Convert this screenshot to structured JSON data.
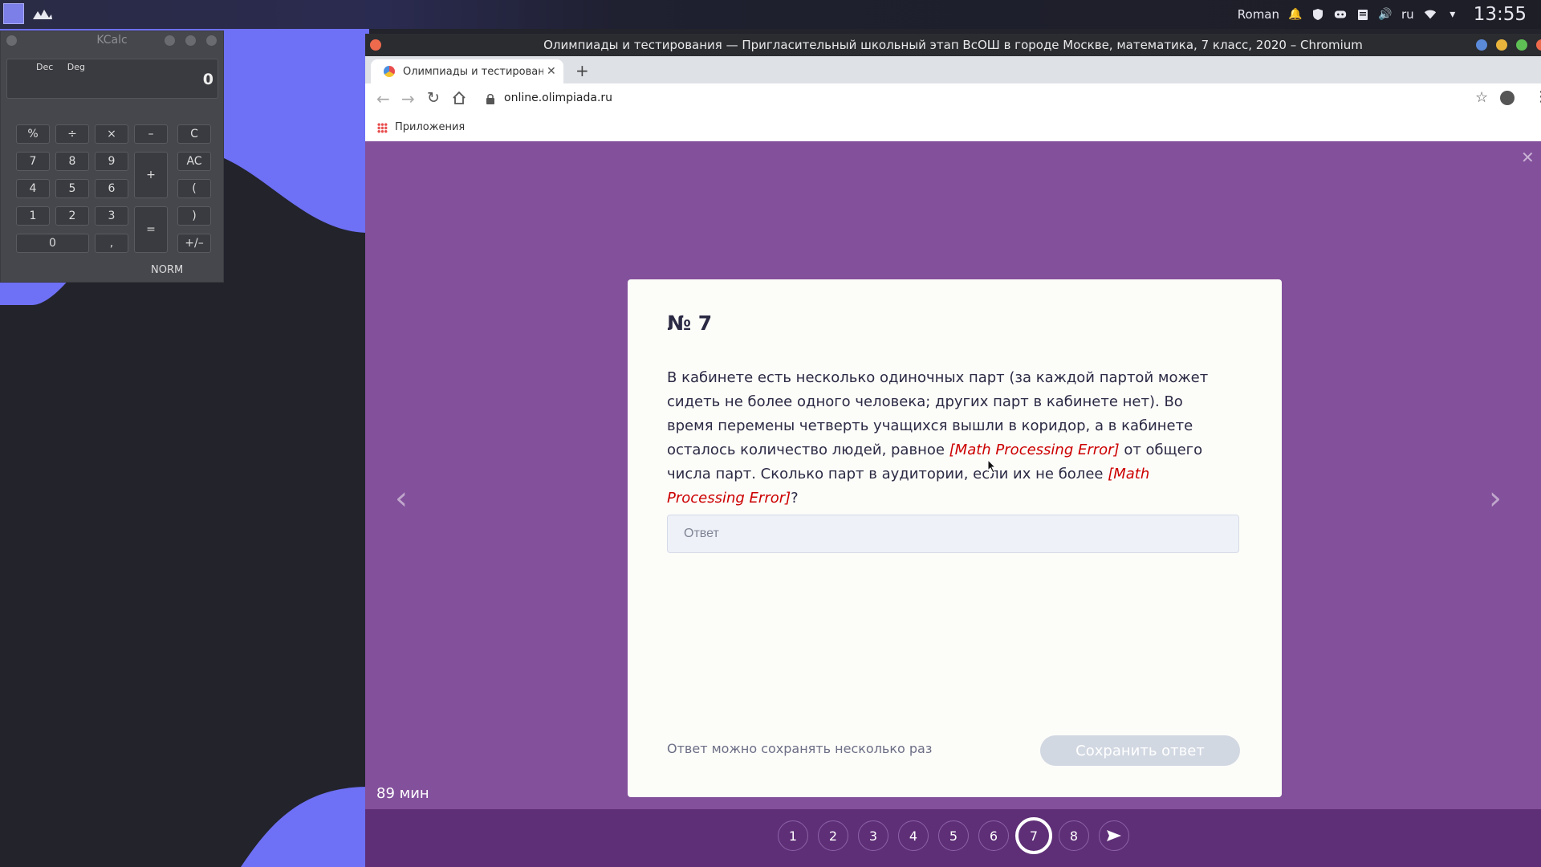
{
  "panel": {
    "user": "Roman",
    "lang": "ru",
    "clock": "13:55"
  },
  "kcalc": {
    "title": "KCalc",
    "flags": [
      "Dec",
      "Deg"
    ],
    "display": "0",
    "buttons": [
      "%",
      "÷",
      "×",
      "–",
      "C",
      "7",
      "8",
      "9",
      "+",
      "AC",
      "4",
      "5",
      "6",
      "(",
      "1",
      "2",
      "3",
      "=",
      ")",
      "0",
      ",",
      "+/–"
    ],
    "mode": "NORM"
  },
  "browser": {
    "window_title": "Олимпиады и тестирования — Пригласительный школьный этап ВсОШ в городе Москве, математика, 7 класс, 2020 – Chromium",
    "tab_title": "Олимпиады и тестирования",
    "url": "online.olimpiada.ru",
    "bookmark_apps": "Приложения"
  },
  "question": {
    "number": "№ 7",
    "text_1": "В кабинете есть несколько одиночных парт (за каждой партой может сидеть не более одного человека; других парт в кабинете нет). Во время перемены четверть учащихся вышли в коридор, а в кабинете осталось количество людей, равное ",
    "error_1": "[Math Processing Error]",
    "text_2": " от общего числа парт. Сколько парт в аудитории, если их не более ",
    "error_2": "[Math Processing Error]",
    "text_3": "?",
    "answer_placeholder": "Ответ",
    "hint": "Ответ можно сохранять несколько раз",
    "save_label": "Сохранить ответ"
  },
  "timer": "89 мин",
  "nav": {
    "pages": [
      "1",
      "2",
      "3",
      "4",
      "5",
      "6",
      "7",
      "8"
    ],
    "active": "7",
    "send_icon": "send-icon"
  },
  "colors": {
    "content_bg": "#83509b",
    "bottom_bar": "#5e2f77",
    "error": "#cc0000"
  }
}
